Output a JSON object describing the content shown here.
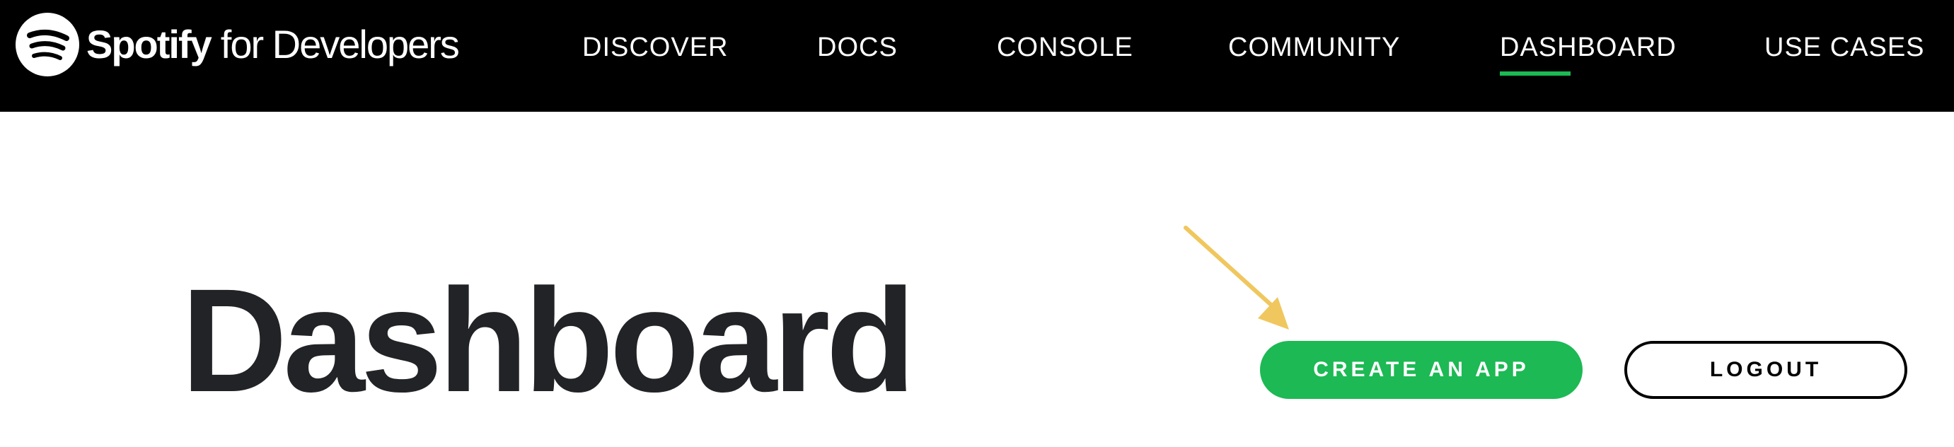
{
  "header": {
    "brand": {
      "logo_icon": "spotify-logo-icon",
      "name": "Spotify",
      "suffix": "for Developers"
    },
    "nav": [
      {
        "label": "DISCOVER",
        "active": false
      },
      {
        "label": "DOCS",
        "active": false
      },
      {
        "label": "CONSOLE",
        "active": false
      },
      {
        "label": "COMMUNITY",
        "active": false
      },
      {
        "label": "DASHBOARD",
        "active": true
      },
      {
        "label": "USE CASES",
        "active": false
      }
    ]
  },
  "main": {
    "title": "Dashboard",
    "create_app_label": "CREATE AN APP",
    "logout_label": "LOGOUT",
    "annotation_icon": "arrow-icon"
  },
  "colors": {
    "header_bg": "#000000",
    "accent": "#1db954",
    "annotation": "#f0c75e",
    "title_text": "#222326"
  }
}
